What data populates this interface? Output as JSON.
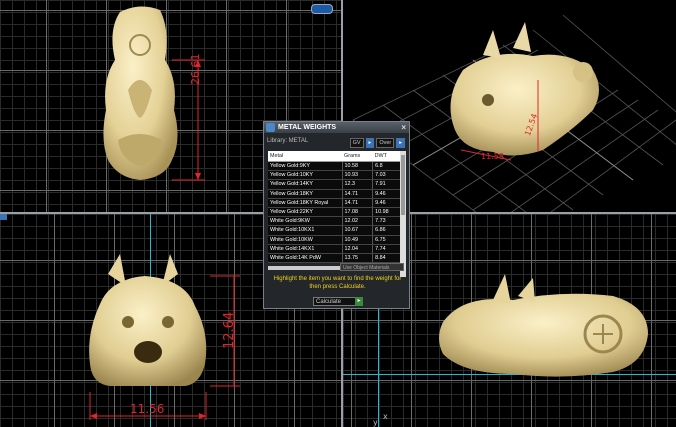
{
  "viewports": {
    "top": {
      "dimension": "26.61"
    },
    "perspective": {
      "dimension_a": "11.58",
      "dimension_b": "12.54"
    },
    "front": {
      "dimension_height": "12.64",
      "dimension_width": "11.56"
    },
    "right": {
      "axis_x": "x",
      "axis_y": "y"
    }
  },
  "panel": {
    "title": "METAL WEIGHTS",
    "library_label": "Library: METAL",
    "units": [
      "GV",
      "Over"
    ],
    "columns": [
      "Metal",
      "Grams",
      "DWT"
    ],
    "rows": [
      [
        "Yellow Gold:9KY",
        "10.58",
        "6.8"
      ],
      [
        "Yellow Gold:10KY",
        "10.93",
        "7.03"
      ],
      [
        "Yellow Gold:14KY",
        "12.3",
        "7.91"
      ],
      [
        "Yellow Gold:18KY",
        "14.71",
        "9.46"
      ],
      [
        "Yellow Gold:18KY Royal",
        "14.71",
        "9.46"
      ],
      [
        "Yellow Gold:22KY",
        "17.08",
        "10.98"
      ],
      [
        "White Gold:9KW",
        "12.02",
        "7.73"
      ],
      [
        "White Gold:10KX1",
        "10.67",
        "6.86"
      ],
      [
        "White Gold:10KW",
        "10.49",
        "6.75"
      ],
      [
        "White Gold:14KX1",
        "12.04",
        "7.74"
      ],
      [
        "White Gold:14K PdW",
        "13.75",
        "8.84"
      ]
    ],
    "use_object_materials": "Use Object Materials",
    "hint": "Highlight the item you want to find the weight for then press Calculate.",
    "calculate_label": "Calculate"
  },
  "colors": {
    "model": "#e9d9a6",
    "dimension": "#e0262b",
    "hint": "#f2d21e"
  }
}
